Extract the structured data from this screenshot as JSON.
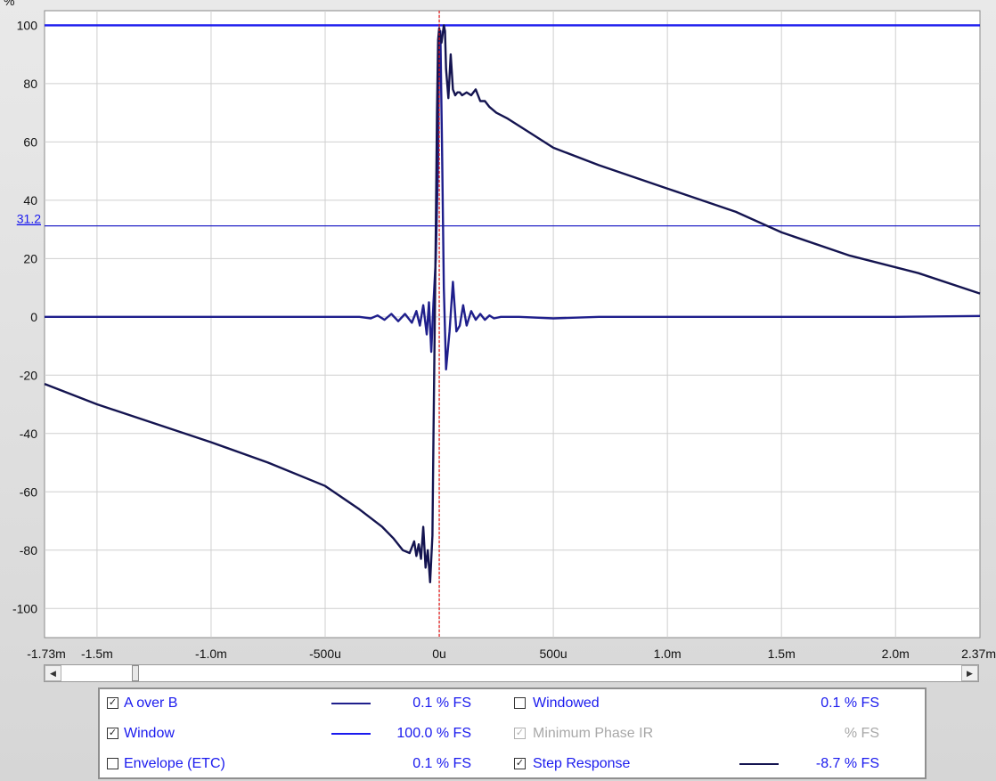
{
  "chart_data": {
    "type": "line",
    "y_unit_label": "%",
    "xlim": [
      -1.73,
      2.37
    ],
    "ylim": [
      -110,
      105
    ],
    "x_ticks": [
      {
        "value": -1.73,
        "label": "-1.73m"
      },
      {
        "value": -1.5,
        "label": "-1.5m"
      },
      {
        "value": -1.0,
        "label": "-1.0m"
      },
      {
        "value": -0.5,
        "label": "-500u"
      },
      {
        "value": 0.0,
        "label": "0u"
      },
      {
        "value": 0.5,
        "label": "500u"
      },
      {
        "value": 1.0,
        "label": "1.0m"
      },
      {
        "value": 1.5,
        "label": "1.5m"
      },
      {
        "value": 2.0,
        "label": "2.0m"
      },
      {
        "value": 2.37,
        "label": "2.37m"
      }
    ],
    "y_ticks": [
      {
        "value": 100,
        "label": "100"
      },
      {
        "value": 80,
        "label": "80"
      },
      {
        "value": 60,
        "label": "60"
      },
      {
        "value": 40,
        "label": "40"
      },
      {
        "value": 20,
        "label": "20"
      },
      {
        "value": 0,
        "label": "0"
      },
      {
        "value": -20,
        "label": "-20"
      },
      {
        "value": -40,
        "label": "-40"
      },
      {
        "value": -60,
        "label": "-60"
      },
      {
        "value": -80,
        "label": "-80"
      },
      {
        "value": -100,
        "label": "-100"
      }
    ],
    "marker_y": {
      "value": 31.2,
      "label": "31.2"
    },
    "cursor_x": 0.0,
    "grid": true,
    "series": [
      {
        "name": "Window",
        "color": "#1a1aee",
        "x": [
          -1.73,
          2.37
        ],
        "y": [
          100,
          100
        ]
      },
      {
        "name": "A over B",
        "color": "#1f1f8c",
        "x": [
          -1.73,
          -1.5,
          -1.0,
          -0.5,
          -0.35,
          -0.3,
          -0.27,
          -0.24,
          -0.21,
          -0.18,
          -0.15,
          -0.12,
          -0.1,
          -0.085,
          -0.07,
          -0.055,
          -0.045,
          -0.035,
          -0.025,
          -0.015,
          -0.005,
          0.0,
          0.005,
          0.012,
          0.02,
          0.03,
          0.045,
          0.06,
          0.075,
          0.09,
          0.105,
          0.12,
          0.14,
          0.16,
          0.18,
          0.2,
          0.22,
          0.24,
          0.27,
          0.3,
          0.35,
          0.5,
          0.7,
          1.0,
          1.5,
          2.0,
          2.37
        ],
        "y": [
          0,
          0,
          0,
          0,
          0,
          -0.5,
          0.5,
          -1,
          1,
          -1.5,
          1,
          -2,
          2,
          -3,
          4,
          -6,
          5,
          -12,
          5,
          20,
          55,
          95,
          98,
          60,
          10,
          -18,
          -5,
          12,
          -5,
          -3,
          4,
          -3,
          2,
          -1,
          1,
          -1,
          0.5,
          -0.5,
          0,
          0,
          0,
          -0.5,
          0,
          0,
          0,
          0,
          0.3
        ]
      },
      {
        "name": "Step Response",
        "color": "#141450",
        "x": [
          -1.73,
          -1.5,
          -1.0,
          -0.75,
          -0.5,
          -0.35,
          -0.25,
          -0.2,
          -0.16,
          -0.13,
          -0.11,
          -0.1,
          -0.09,
          -0.08,
          -0.07,
          -0.06,
          -0.05,
          -0.04,
          -0.03,
          -0.025,
          -0.02,
          -0.015,
          -0.01,
          -0.005,
          0.0,
          0.005,
          0.01,
          0.015,
          0.02,
          0.025,
          0.03,
          0.04,
          0.05,
          0.06,
          0.07,
          0.08,
          0.09,
          0.1,
          0.12,
          0.14,
          0.16,
          0.18,
          0.2,
          0.22,
          0.25,
          0.3,
          0.4,
          0.5,
          0.7,
          1.0,
          1.3,
          1.5,
          1.8,
          2.1,
          2.37
        ],
        "y": [
          -23,
          -30,
          -43,
          -50,
          -58,
          -66,
          -72,
          -76,
          -80,
          -81,
          -77,
          -82,
          -78,
          -83,
          -72,
          -86,
          -80,
          -91,
          -75,
          -40,
          -5,
          30,
          70,
          95,
          99,
          96,
          94,
          97,
          100,
          98,
          85,
          75,
          90,
          78,
          76,
          77,
          77,
          76,
          77,
          76,
          78,
          74,
          74,
          72,
          70,
          68,
          63,
          58,
          52,
          44,
          36,
          29,
          21,
          15,
          8
        ]
      }
    ]
  },
  "legend": {
    "rows": [
      {
        "left": {
          "label": "A over B",
          "checked": true,
          "dimmed": false,
          "value": "0.1 % FS",
          "swatch": "#1f1f8c"
        },
        "right": {
          "label": "Windowed",
          "checked": false,
          "dimmed": false,
          "value": "0.1 % FS",
          "swatch": null
        }
      },
      {
        "left": {
          "label": "Window",
          "checked": true,
          "dimmed": false,
          "value": "100.0 % FS",
          "swatch": "#1a1aee"
        },
        "right": {
          "label": "Minimum Phase IR",
          "checked": true,
          "dimmed": true,
          "value": "% FS",
          "swatch": null
        }
      },
      {
        "left": {
          "label": "Envelope (ETC)",
          "checked": false,
          "dimmed": false,
          "value": "0.1 % FS",
          "swatch": null
        },
        "right": {
          "label": "Step Response",
          "checked": true,
          "dimmed": false,
          "value": "-8.7 % FS",
          "swatch": "#141450"
        }
      }
    ]
  },
  "colors": {
    "label_blue": "#1a1aee",
    "label_dim": "#a8a8a8",
    "value_blue": "#1a1aee"
  }
}
